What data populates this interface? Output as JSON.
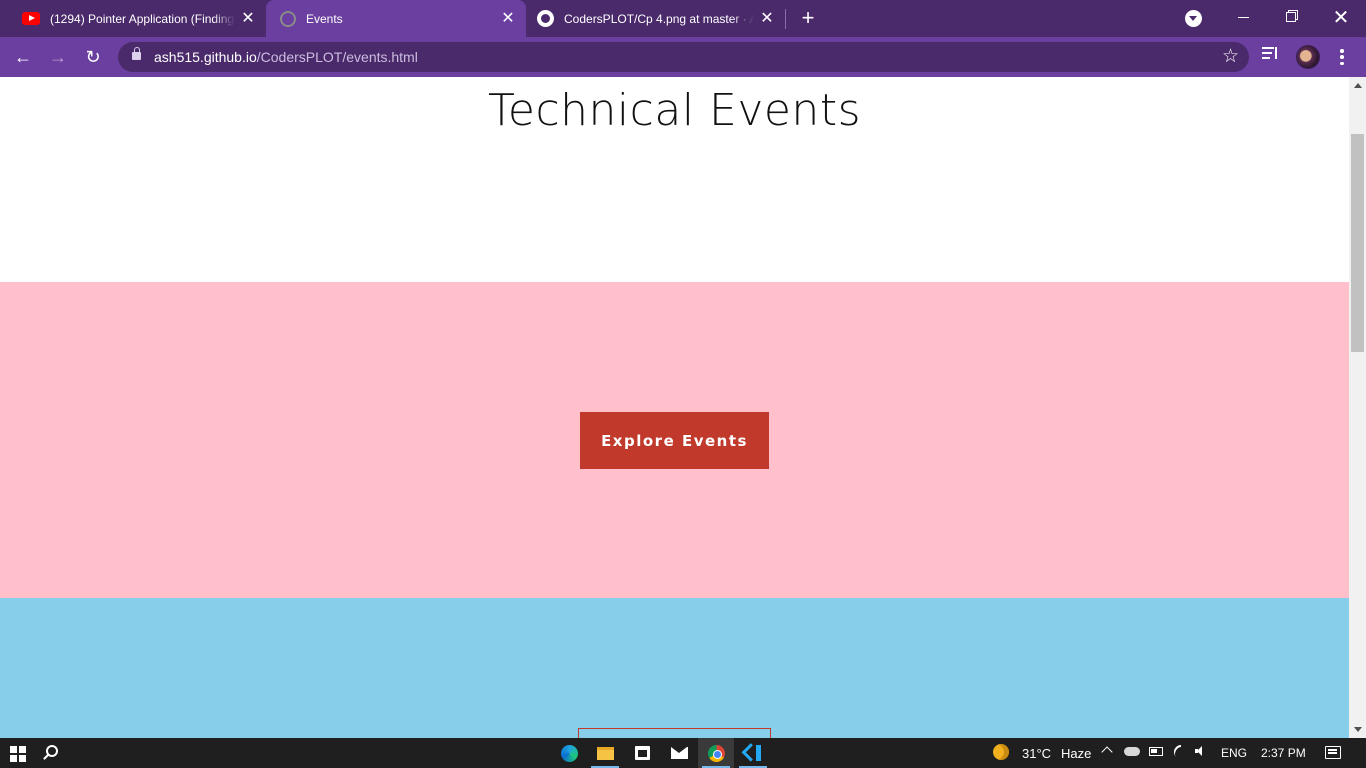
{
  "browser": {
    "tabs": [
      {
        "title": "(1294) Pointer Application (Finding t",
        "icon": "youtube-icon",
        "active": false
      },
      {
        "title": "Events",
        "icon": "globe-icon",
        "active": true
      },
      {
        "title": "CodersPLOT/Cp 4.png at master · As",
        "icon": "github-icon",
        "active": false
      }
    ],
    "new_tab_label": "+",
    "close_glyph": "✕",
    "url_host": "ash515.github.io",
    "url_path": "/CodersPLOT/events.html",
    "colors": {
      "frame": "#4a2a6b",
      "toolbar": "#6b3fa0"
    }
  },
  "page": {
    "title": "Technical Events",
    "explore_button": "Explore Events",
    "colors": {
      "pink_section": "#ffc0cb",
      "blue_section": "#87ceeb",
      "button": "#c0392b"
    }
  },
  "taskbar": {
    "apps": [
      "edge-icon",
      "file-explorer-icon",
      "store-icon",
      "mail-icon",
      "chrome-icon",
      "vscode-icon"
    ],
    "weather_temp": "31°C",
    "weather_condition": "Haze",
    "language": "ENG",
    "time": "2:37 PM"
  }
}
